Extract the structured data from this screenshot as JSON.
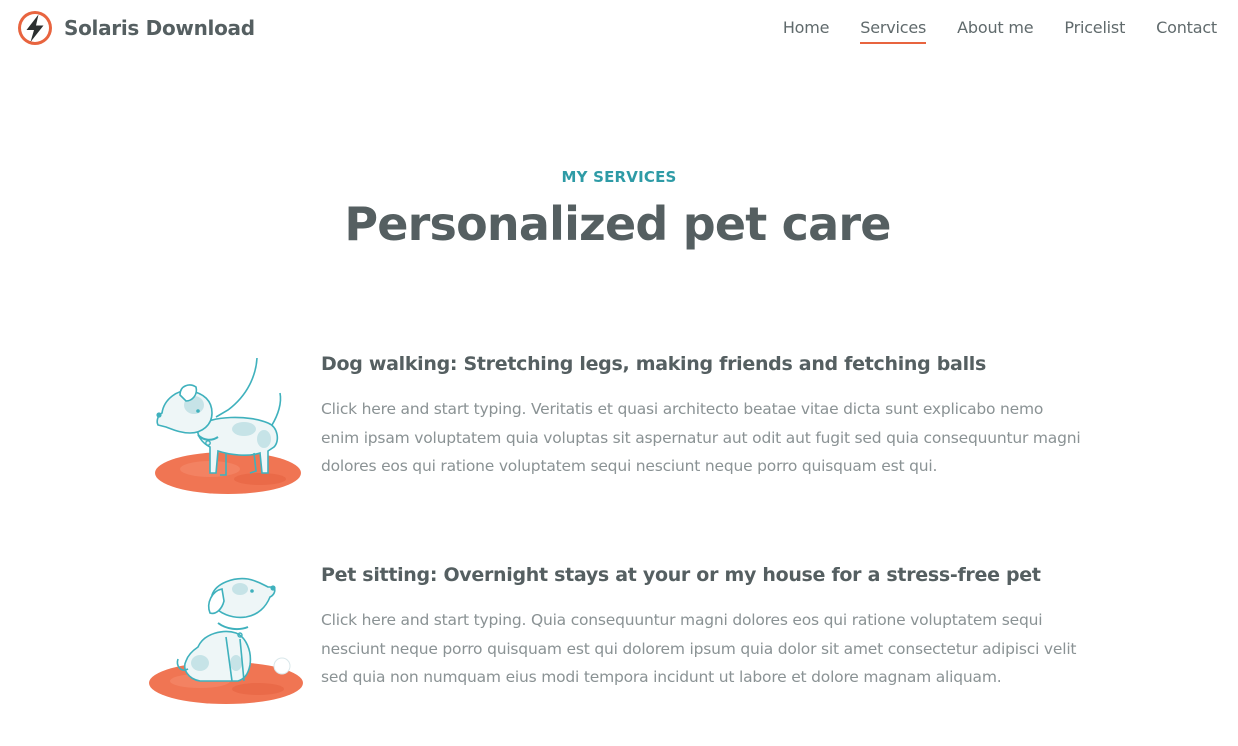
{
  "brand": {
    "name": "Solaris Download",
    "logo_icon": "lightning-bolt-icon",
    "accent_color": "#e8643f"
  },
  "nav": {
    "items": [
      {
        "label": "Home"
      },
      {
        "label": "Services",
        "active": true
      },
      {
        "label": "About me"
      },
      {
        "label": "Pricelist"
      },
      {
        "label": "Contact"
      }
    ]
  },
  "section": {
    "eyebrow": "MY SERVICES",
    "title": "Personalized pet care",
    "eyebrow_color": "#2e9ba6"
  },
  "services": [
    {
      "title": "Dog walking: Stretching legs, making friends and fetching balls",
      "description": "Click here and start typing. Veritatis et quasi architecto beatae vitae dicta sunt explicabo nemo enim ipsam voluptatem quia voluptas sit aspernatur aut odit aut fugit sed quia consequuntur magni dolores eos qui ratione voluptatem sequi nesciunt neque porro quisquam est qui.",
      "illustration_icon": "dog-on-leash-icon"
    },
    {
      "title": "Pet sitting: Overnight stays at your or my house for a stress-free pet",
      "description": "Click here and start typing. Quia consequuntur magni dolores eos qui ratione voluptatem sequi nesciunt neque porro quisquam est qui dolorem ipsum quia dolor sit amet consectetur adipisci velit sed quia non numquam eius modi tempora incidunt ut labore et dolore magnam aliquam.",
      "illustration_icon": "sitting-dog-icon"
    }
  ]
}
